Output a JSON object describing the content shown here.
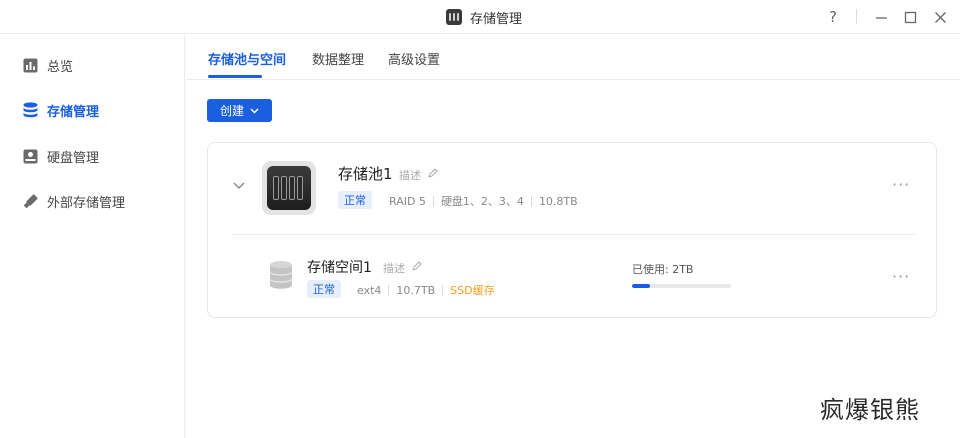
{
  "window": {
    "title": "存储管理",
    "help": "?",
    "controls": [
      "minimize",
      "maximize",
      "close"
    ]
  },
  "sidebar": {
    "items": [
      {
        "label": "总览",
        "icon": "chart-icon",
        "active": false
      },
      {
        "label": "存储管理",
        "icon": "database-icon",
        "active": true
      },
      {
        "label": "硬盘管理",
        "icon": "hard-disk-icon",
        "active": false
      },
      {
        "label": "外部存储管理",
        "icon": "usb-drive-icon",
        "active": false
      }
    ]
  },
  "tabs": [
    {
      "label": "存储池与空间",
      "active": true
    },
    {
      "label": "数据整理",
      "active": false
    },
    {
      "label": "高级设置",
      "active": false
    }
  ],
  "toolbar": {
    "create_label": "创建"
  },
  "pool": {
    "name": "存储池1",
    "desc_label": "描述",
    "status": "正常",
    "raid": "RAID 5",
    "disks": "硬盘1、2、3、4",
    "capacity": "10.8TB",
    "more": "···"
  },
  "space": {
    "name": "存储空间1",
    "desc_label": "描述",
    "status": "正常",
    "fs": "ext4",
    "capacity": "10.7TB",
    "cache": "SSD缓存",
    "used_label": "已使用: 2TB",
    "used_fraction": 0.18,
    "more": "···"
  },
  "watermark": "疯爆银熊",
  "colors": {
    "accent": "#1a5fe0",
    "ssd": "#f0a020"
  }
}
